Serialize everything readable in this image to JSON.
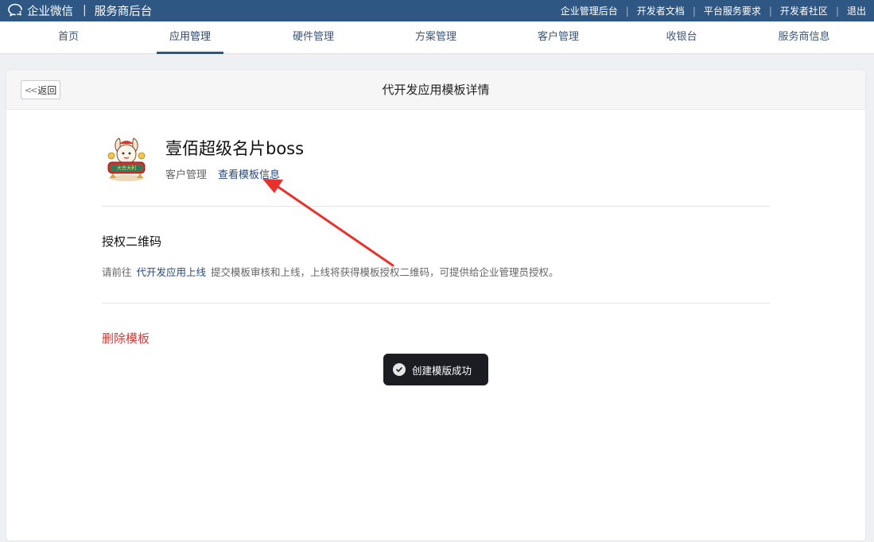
{
  "topbar": {
    "brand": "企业微信",
    "separator": "|",
    "subtitle": "服务商后台",
    "links": [
      "企业管理后台",
      "开发者文档",
      "平台服务要求",
      "开发者社区",
      "退出"
    ],
    "link_separator": "|"
  },
  "nav": {
    "items": [
      "首页",
      "应用管理",
      "硬件管理",
      "方案管理",
      "客户管理",
      "收银台",
      "服务商信息"
    ],
    "active": "应用管理"
  },
  "panel": {
    "back_label": "返回",
    "title": "代开发应用模板详情"
  },
  "app": {
    "name": "壹佰超级名片boss",
    "category": "客户管理",
    "template_link": "查看模板信息",
    "logo_text": "大吉大利"
  },
  "auth": {
    "title": "授权二维码",
    "desc_prefix": "请前往",
    "desc_link": "代开发应用上线",
    "desc_suffix": "提交模板审核和上线，上线将获得模板授权二维码，可提供给企业管理员授权。"
  },
  "delete_label": "删除模板",
  "toast": {
    "message": "创建模版成功"
  },
  "colors": {
    "topbar": "#2f5784",
    "link": "#2a4a78",
    "danger": "#cc3f3a",
    "annotation_arrow": "#e8322b"
  }
}
